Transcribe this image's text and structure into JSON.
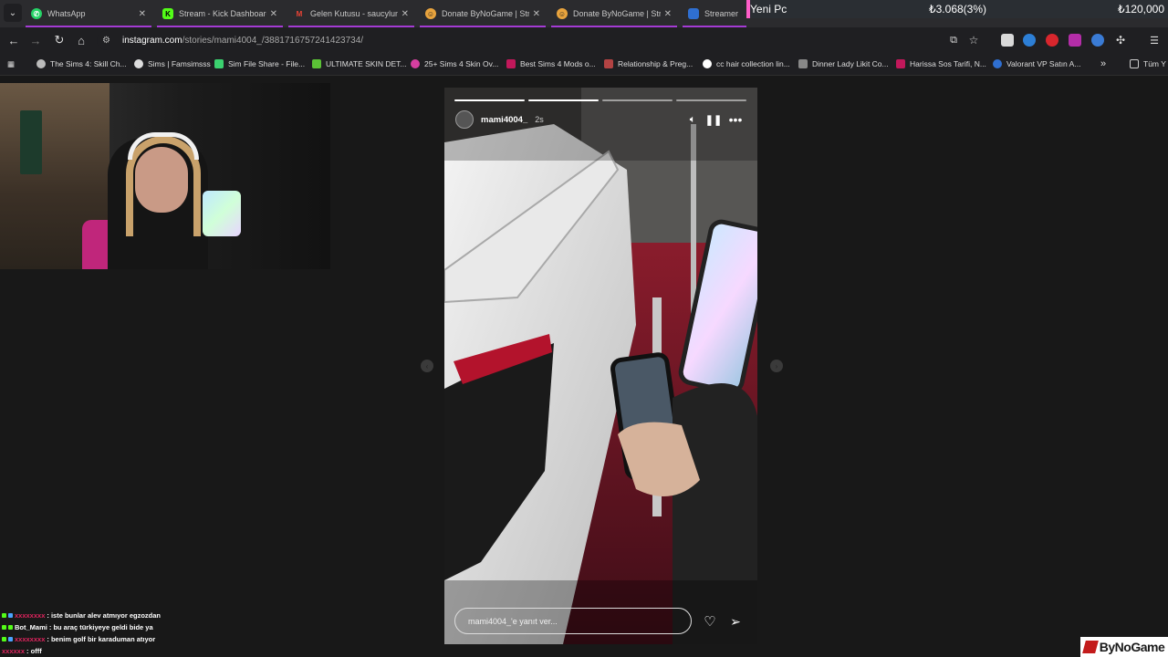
{
  "ticker": {
    "label": "Yeni Pc",
    "progress_text": "₺3.068(3%)",
    "goal_text": "₺120,000",
    "accent": "#ff5ec8"
  },
  "tabs": [
    {
      "title": "WhatsApp",
      "icon": "whatsapp-icon",
      "color": "#25d366"
    },
    {
      "title": "Stream - Kick Dashboard",
      "icon": "kick-icon",
      "color": "#53fc18"
    },
    {
      "title": "Gelen Kutusu - saucylumi",
      "icon": "gmail-icon",
      "color": "#ea4335"
    },
    {
      "title": "Donate ByNoGame | Stre",
      "icon": "bynogame-icon",
      "color": "#e8a33d"
    },
    {
      "title": "Donate ByNoGame | Stre",
      "icon": "bynogame-icon",
      "color": "#e8a33d"
    },
    {
      "title": "Streamer Par",
      "icon": "bynogame-icon",
      "color": "#2f6fd1"
    }
  ],
  "address": {
    "host": "instagram.com",
    "path": "/stories/mami4004_/3881716757241423734/"
  },
  "bookmarks": [
    {
      "label": "The Sims 4: Skill Ch...",
      "color": "#bbbbbb"
    },
    {
      "label": "Sims | Famsimsss",
      "color": "#dddddd"
    },
    {
      "label": "Sim File Share - File...",
      "color": "#3bd16f"
    },
    {
      "label": "ULTIMATE SKIN DET...",
      "color": "#5bc236"
    },
    {
      "label": "25+ Sims 4 Skin Ov...",
      "color": "#d63fa0"
    },
    {
      "label": "Best Sims 4 Mods o...",
      "color": "#c2185b"
    },
    {
      "label": "Relationship & Preg...",
      "color": "#b34343"
    },
    {
      "label": "cc hair collection lin...",
      "color": "#ffffff"
    },
    {
      "label": "Dinner Lady Likit Co...",
      "color": "#888888"
    },
    {
      "label": "Harissa Sos Tarifi, N...",
      "color": "#c2185b"
    },
    {
      "label": "Valorant VP Satın A...",
      "color": "#2f6fd1"
    }
  ],
  "bookmarks_more": "»",
  "bookmarks_all": "Tüm Y",
  "story": {
    "username": "mami4004_",
    "time": "2s",
    "reply_placeholder": "mami4004_'e yanıt ver...",
    "progress_segments": 4,
    "current_segment": 2
  },
  "chat": [
    {
      "user": "xxxxxxxx",
      "user_color": "#e0245e",
      "message": "iste bunlar alev atmıyor egzozdan"
    },
    {
      "user": "Bot_Mami",
      "user_color": "#ffffff",
      "message": "bu araç türkiyeye geldi bide ya"
    },
    {
      "user": "xxxxxxxx",
      "user_color": "#e0245e",
      "message": "benim golf bir karaduman atıyor"
    },
    {
      "user": "xxxxxx",
      "user_color": "#e0245e",
      "message": "offf"
    }
  ],
  "watermark": "ByNoGame"
}
